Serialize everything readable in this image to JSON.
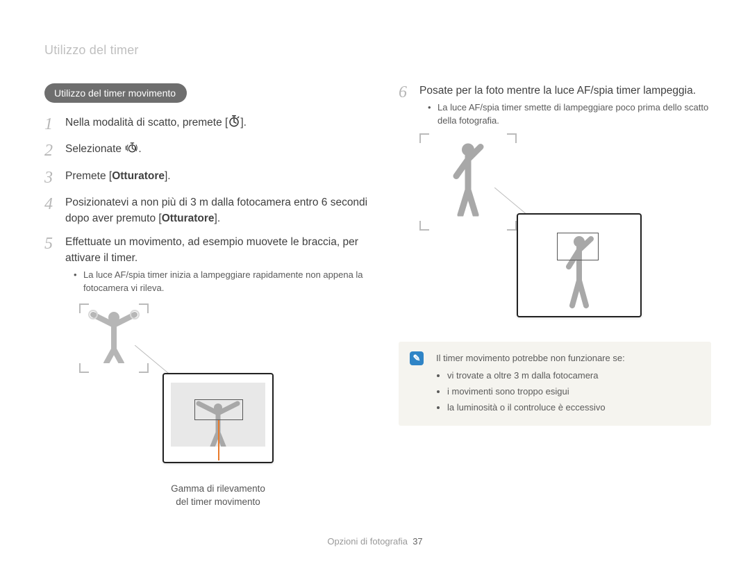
{
  "page_title": "Utilizzo del timer",
  "section_heading": "Utilizzo del timer movimento",
  "steps": {
    "s1": "Nella modalità di scatto, premete [",
    "s1_tail": "].",
    "s2": "Selezionate ",
    "s2_tail": ".",
    "s3_pre": "Premete [",
    "s3_bold": "Otturatore",
    "s3_post": "].",
    "s4_a": "Posizionatevi a non più di 3 m dalla fotocamera entro 6 secondi dopo aver premuto [",
    "s4_bold": "Otturatore",
    "s4_post": "].",
    "s5": "Effettuate un movimento, ad esempio muovete le braccia, per attivare il timer.",
    "s5_sub": "La luce AF/spia timer inizia a lampeggiare rapidamente non appena la fotocamera vi rileva.",
    "s6": "Posate per la foto mentre la luce AF/spia timer lampeggia.",
    "s6_sub": "La luce AF/spia timer smette di lampeggiare poco prima dello scatto della fotografia."
  },
  "illus_caption_left_1": "Gamma di rilevamento",
  "illus_caption_left_2": "del timer movimento",
  "note": {
    "title": "Il timer movimento potrebbe non funzionare se:",
    "items": [
      "vi trovate a oltre 3 m dalla fotocamera",
      "i movimenti sono troppo esigui",
      "la luminosità o il controluce è eccessivo"
    ]
  },
  "footer_section": "Opzioni di fotografia",
  "footer_page": "37",
  "icons": {
    "timer": "timer-icon",
    "motion": "motion-timer-icon",
    "note": "note-icon"
  }
}
